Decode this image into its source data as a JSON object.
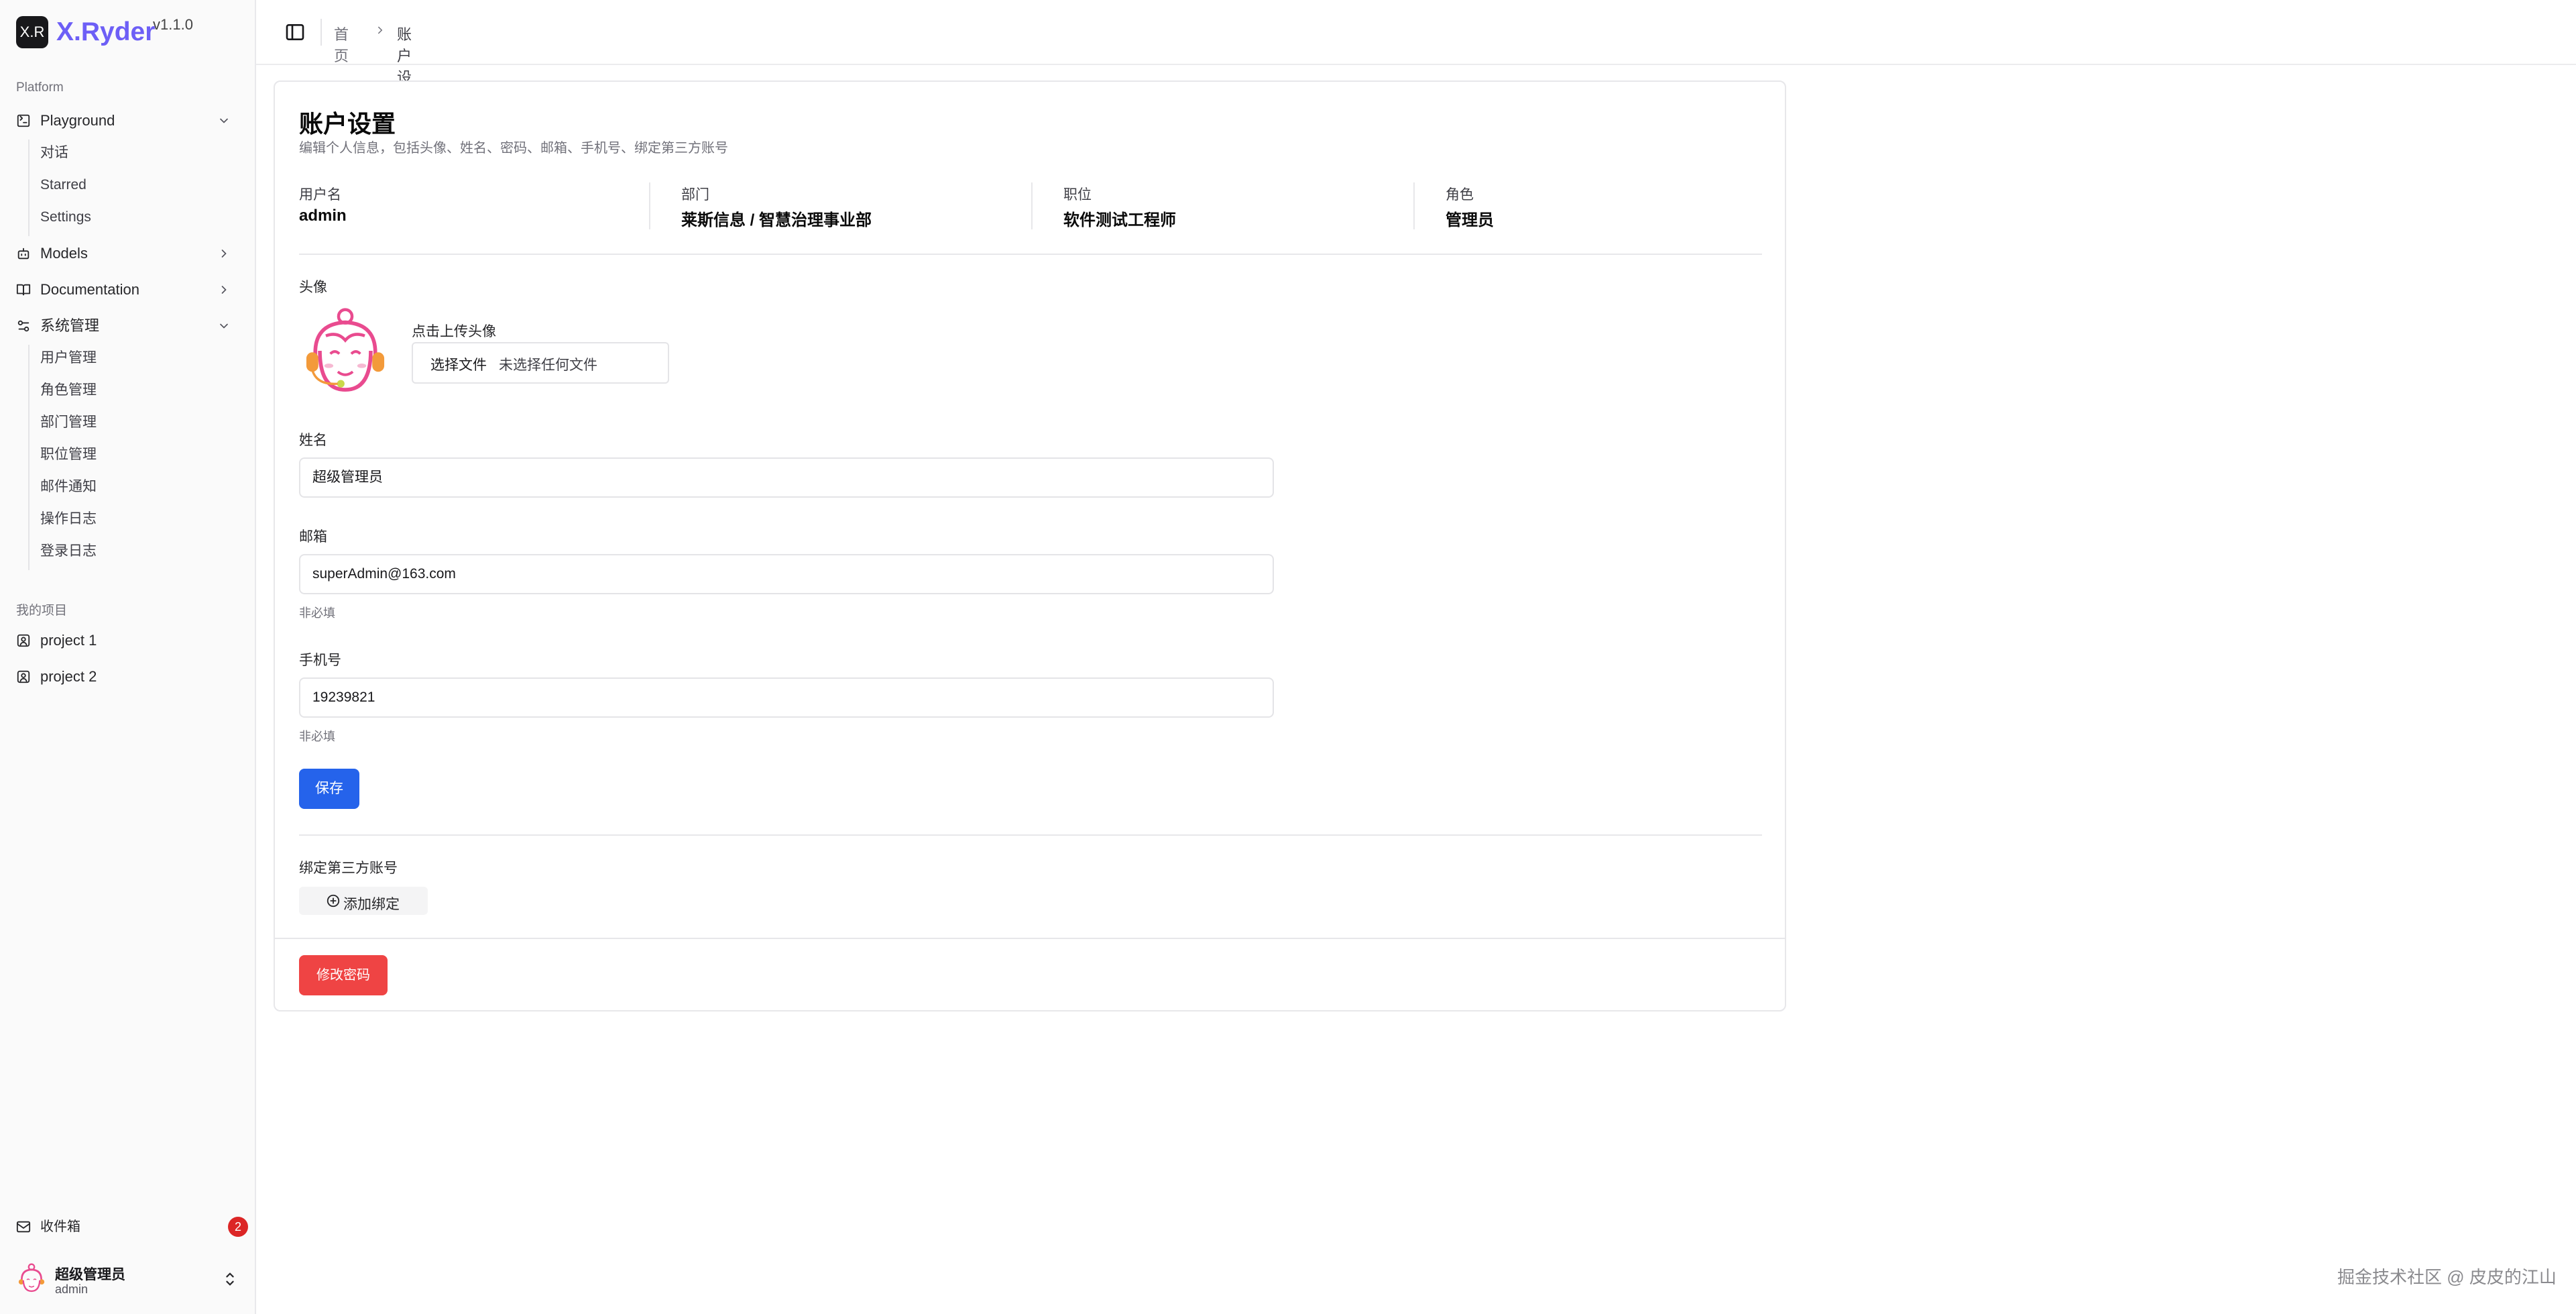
{
  "brand": {
    "logo": "X.R",
    "name": "X.Ryder",
    "version": "v1.1.0"
  },
  "sidebar": {
    "platform_label": "Platform",
    "playground": {
      "label": "Playground",
      "icon": "terminal-square-icon",
      "children": [
        "对话",
        "Starred",
        "Settings"
      ]
    },
    "models": {
      "label": "Models",
      "icon": "bot-icon"
    },
    "documentation": {
      "label": "Documentation",
      "icon": "book-open-icon"
    },
    "system": {
      "label": "系统管理",
      "icon": "settings-2-icon",
      "children": [
        "用户管理",
        "角色管理",
        "部门管理",
        "职位管理",
        "邮件通知",
        "操作日志",
        "登录日志"
      ]
    },
    "projects_label": "我的项目",
    "projects": [
      "project 1",
      "project 2"
    ],
    "inbox": {
      "label": "收件箱",
      "count": "2"
    },
    "user": {
      "name": "超级管理员",
      "account": "admin"
    }
  },
  "header": {
    "breadcrumb": [
      "首页",
      "账户设置"
    ]
  },
  "card": {
    "title": "账户设置",
    "subtitle": "编辑个人信息，包括头像、姓名、密码、邮箱、手机号、绑定第三方账号",
    "info": [
      {
        "label": "用户名",
        "value": "admin"
      },
      {
        "label": "部门",
        "value": "莱斯信息 / 智慧治理事业部"
      },
      {
        "label": "职位",
        "value": "软件测试工程师"
      },
      {
        "label": "角色",
        "value": "管理员"
      }
    ],
    "avatar": {
      "label": "头像",
      "upload_hint": "点击上传头像",
      "file_button": "选择文件",
      "file_status": "未选择任何文件"
    },
    "name": {
      "label": "姓名",
      "value": "超级管理员"
    },
    "email": {
      "label": "邮箱",
      "value": "superAdmin@163.com",
      "hint": "非必填"
    },
    "phone": {
      "label": "手机号",
      "value": "19239821",
      "hint": "非必填"
    },
    "save_label": "保存",
    "third_party": {
      "label": "绑定第三方账号",
      "add_label": "添加绑定"
    },
    "change_password_label": "修改密码"
  },
  "watermark": "掘金技术社区 @ 皮皮的江山",
  "colors": {
    "primary": "#2563eb",
    "danger": "#ef4444",
    "brand": "#6d5ff6",
    "badge": "#dc2626"
  }
}
